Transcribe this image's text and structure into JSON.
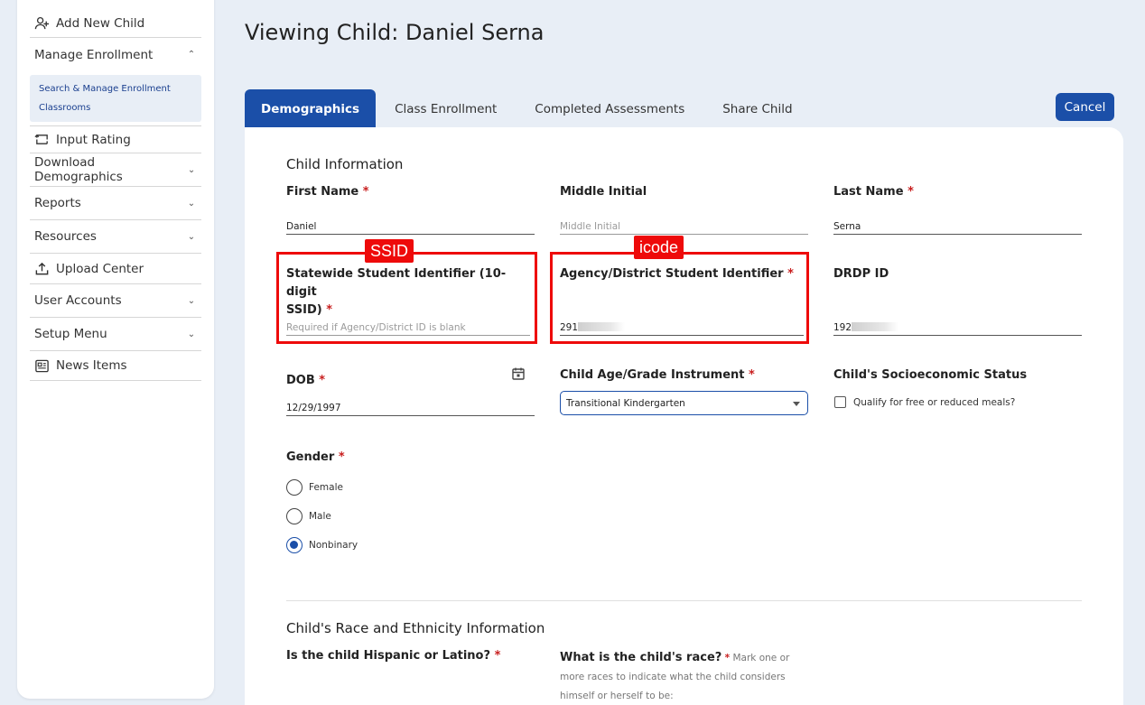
{
  "sidebar": {
    "items": [
      {
        "label": "Add New Child"
      },
      {
        "label": "Manage Enrollment"
      },
      {
        "label": "Input Rating"
      },
      {
        "label": "Download Demographics"
      },
      {
        "label": "Reports"
      },
      {
        "label": "Resources"
      },
      {
        "label": "Upload Center"
      },
      {
        "label": "User Accounts"
      },
      {
        "label": "Setup Menu"
      },
      {
        "label": "News Items"
      }
    ],
    "submenu": [
      "Search & Manage Enrollment",
      "Classrooms"
    ]
  },
  "page": {
    "title": "Viewing Child: Daniel Serna"
  },
  "tabs": [
    {
      "label": "Demographics"
    },
    {
      "label": "Class Enrollment"
    },
    {
      "label": "Completed Assessments"
    },
    {
      "label": "Share Child"
    }
  ],
  "cancel_label": "Cancel",
  "child_info": {
    "title": "Child Information",
    "first_name": {
      "label": "First Name",
      "value": "Daniel"
    },
    "middle_initial": {
      "label": "Middle Initial",
      "placeholder": "Middle Initial"
    },
    "last_name": {
      "label": "Last Name",
      "value": "Serna"
    },
    "ssid": {
      "label_line1": "Statewide Student Identifier (10-digit",
      "label_line2": "SSID)",
      "placeholder": "Required if Agency/District ID is blank"
    },
    "district_id": {
      "label": "Agency/District Student Identifier",
      "value": "291"
    },
    "drdp_id": {
      "label": "DRDP ID",
      "value": "192"
    },
    "dob": {
      "label": "DOB",
      "value": "12/29/1997"
    },
    "age_grade": {
      "label": "Child Age/Grade Instrument",
      "value": "Transitional Kindergarten"
    },
    "socioeconomic": {
      "label": "Child's Socioeconomic Status",
      "checkbox_label": "Qualify for free or reduced meals?"
    },
    "gender": {
      "label": "Gender",
      "options": [
        "Female",
        "Male",
        "Nonbinary"
      ],
      "selected": "Nonbinary"
    }
  },
  "annotations": {
    "ssid_tag": "SSID",
    "icode_tag": "icode",
    "color": "#ee0a0a"
  },
  "race": {
    "title": "Child's Race and Ethnicity Information",
    "hispanic_label": "Is the child Hispanic or Latino?",
    "race_label": "What is the child's race?",
    "race_note": "Mark one or more races to indicate what the child considers himself or herself to be:"
  },
  "required_mark": "*",
  "colors": {
    "accent": "#1b4fa8",
    "required": "#c81e1e"
  }
}
